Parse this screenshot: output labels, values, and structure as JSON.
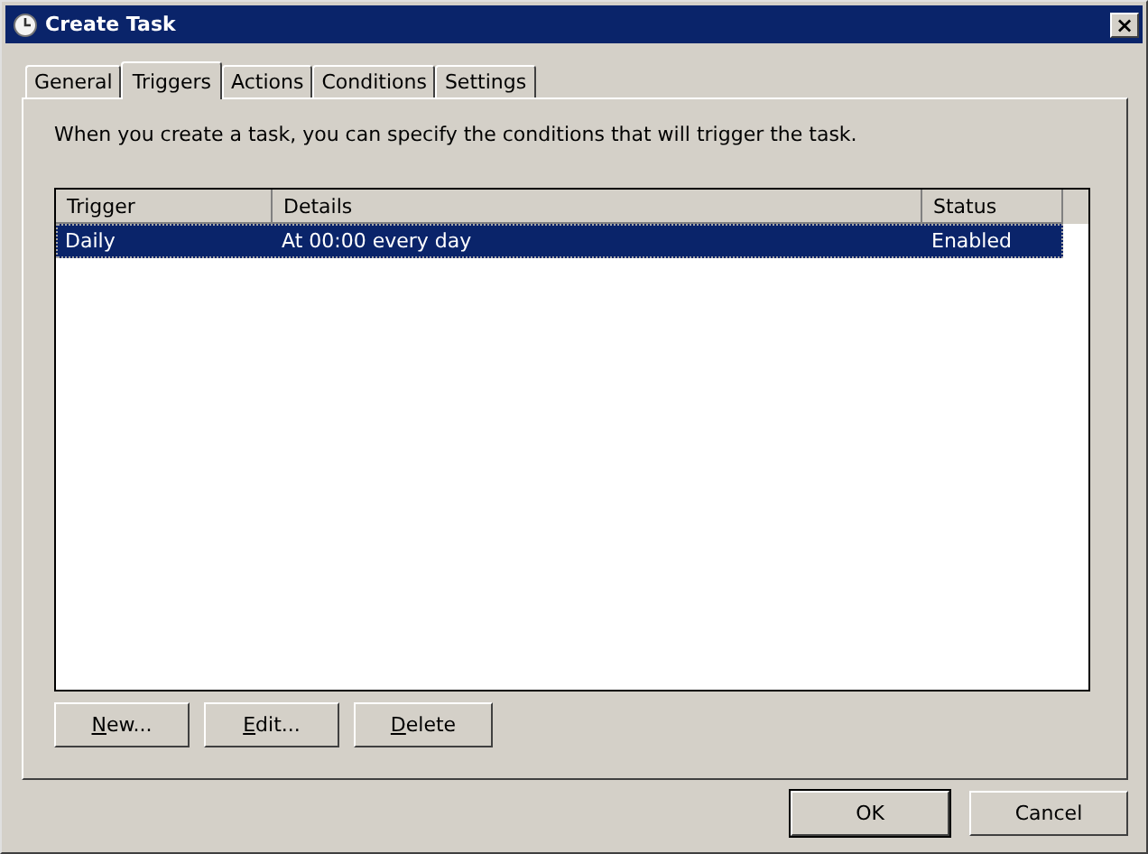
{
  "window": {
    "title": "Create Task",
    "close": "×"
  },
  "tabs": [
    {
      "label": "General",
      "selected": false
    },
    {
      "label": "Triggers",
      "selected": true
    },
    {
      "label": "Actions",
      "selected": false
    },
    {
      "label": "Conditions",
      "selected": false
    },
    {
      "label": "Settings",
      "selected": false
    }
  ],
  "description": "When you create a task, you can specify the conditions that will trigger the task.",
  "table": {
    "columns": [
      "Trigger",
      "Details",
      "Status"
    ],
    "rows": [
      {
        "cells": [
          "Daily",
          "At 00:00 every day",
          "Enabled"
        ],
        "selected": true
      }
    ]
  },
  "actions": [
    {
      "label": "New...",
      "first_letter_underlined": true
    },
    {
      "label": "Edit...",
      "first_letter_underlined": true
    },
    {
      "label": "Delete",
      "first_letter_underlined": true
    }
  ],
  "buttons": [
    {
      "label": "OK",
      "default": true
    },
    {
      "label": "Cancel",
      "default": false
    }
  ]
}
